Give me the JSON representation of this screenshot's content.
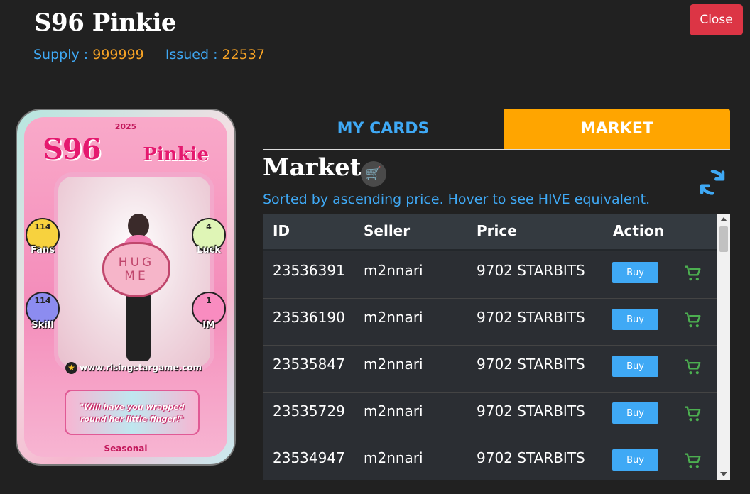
{
  "header": {
    "title": "S96 Pinkie",
    "supply_label": "Supply :",
    "supply_value": "999999",
    "issued_label": "Issued :",
    "issued_value": "22537",
    "close_label": "Close"
  },
  "card": {
    "year": "2025",
    "code": "S96",
    "name": "Pinkie",
    "heart_text_line1": "HUG",
    "heart_text_line2": "ME",
    "stats": [
      {
        "value": "114",
        "label": "Fans"
      },
      {
        "value": "4",
        "label": "Luck"
      },
      {
        "value": "114",
        "label": "Skill"
      },
      {
        "value": "1",
        "label": "IM"
      }
    ],
    "url": "www.risingstargame.com",
    "quote": "\"Will have you wrapped round her little finger!\"",
    "rarity": "Seasonal"
  },
  "tabs": {
    "my_cards": "MY CARDS",
    "market": "MARKET"
  },
  "market": {
    "heading": "Market",
    "sort_note": "Sorted by ascending price. Hover to see HIVE equivalent.",
    "columns": [
      "ID",
      "Seller",
      "Price",
      "Action"
    ],
    "buy_label": "Buy",
    "rows": [
      {
        "id": "23536391",
        "seller": "m2nnari",
        "price": "9702 STARBITS"
      },
      {
        "id": "23536190",
        "seller": "m2nnari",
        "price": "9702 STARBITS"
      },
      {
        "id": "23535847",
        "seller": "m2nnari",
        "price": "9702 STARBITS"
      },
      {
        "id": "23535729",
        "seller": "m2nnari",
        "price": "9702 STARBITS"
      },
      {
        "id": "23534947",
        "seller": "m2nnari",
        "price": "9702 STARBITS"
      }
    ]
  },
  "colors": {
    "background": "#212121",
    "accent_blue": "#3fa9f5",
    "accent_orange": "#ffa500",
    "value_orange": "#f7a325",
    "close_red": "#dc3545",
    "cart_green": "#4caf50"
  },
  "icons": [
    "shopping-cart-icon",
    "refresh-icon",
    "add-to-cart-icon"
  ]
}
